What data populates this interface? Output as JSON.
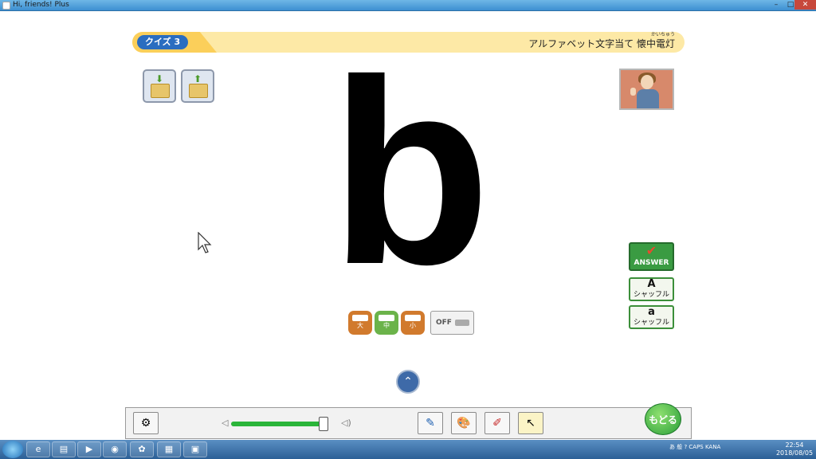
{
  "window": {
    "title": "Hi, friends! Plus",
    "controls": {
      "minimize": "–",
      "maximize": "□",
      "close": "✕"
    }
  },
  "quiz": {
    "label": "クイズ 3",
    "title": "アルファベット文字当て 懐中電灯",
    "ruby": "かいちゅう"
  },
  "folders": [
    {
      "name": "load-folder-button",
      "icon": "folder-download-icon",
      "arrow": "⬇"
    },
    {
      "name": "save-folder-button",
      "icon": "folder-upload-icon",
      "arrow": "⬆"
    }
  ],
  "teacher_icon": "teacher-icon",
  "display": {
    "letter": "b"
  },
  "flashlight": {
    "large_label": "大",
    "medium_label": "中",
    "small_label": "小",
    "off_label": "OFF"
  },
  "side": {
    "answer_label": "ANSWER",
    "answer_check": "✔",
    "upper_letter": "A",
    "upper_label": "シャッフル",
    "lower_letter": "a",
    "lower_label": "シャッフル"
  },
  "scroll_up": "⌃",
  "toolbar": {
    "settings_icon": "⚙",
    "volume_low": "◁",
    "volume_high": "◁)",
    "volume_level": 0.95,
    "pen_icon": "✎",
    "palette_icon": "🎨",
    "eraser_icon": "✐",
    "pointer_icon": "↖",
    "back_label": "もどる"
  },
  "taskbar": {
    "items": [
      "e",
      "▤",
      "▶",
      "◉",
      "✿",
      "▦",
      "▣"
    ],
    "tray_text": "あ 般 ? CAPS KANA",
    "time": "22:54",
    "date": "2018/08/05"
  },
  "colors": {
    "accent_blue": "#2a6dc0",
    "answer_green": "#3a9b42",
    "quizbar_yellow": "#fde9a6"
  }
}
